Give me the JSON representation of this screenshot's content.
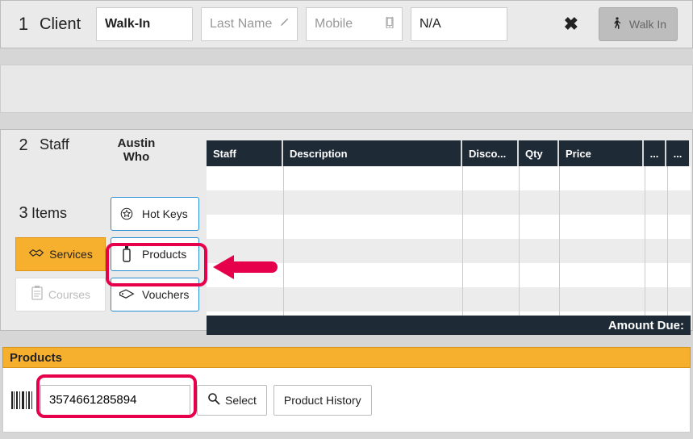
{
  "client": {
    "step": "1",
    "label": "Client",
    "first_name": "Walk-In",
    "last_name_placeholder": "Last Name",
    "mobile_placeholder": "Mobile",
    "extra": "N/A",
    "walkin_label": "Walk In"
  },
  "staff": {
    "step": "2",
    "label": "Staff",
    "name_line1": "Austin",
    "name_line2": "Who"
  },
  "items": {
    "step": "3",
    "label": "Items",
    "services_label": "Services",
    "courses_label": "Courses",
    "hotkeys_label": "Hot Keys",
    "products_label": "Products",
    "vouchers_label": "Vouchers"
  },
  "table": {
    "headers": {
      "staff": "Staff",
      "description": "Description",
      "discount": "Disco...",
      "qty": "Qty",
      "price": "Price",
      "more1": "...",
      "more2": "..."
    },
    "footer": "Amount Due:"
  },
  "products_panel": {
    "title": "Products",
    "barcode_value": "3574661285894",
    "select_label": "Select",
    "history_label": "Product History"
  }
}
